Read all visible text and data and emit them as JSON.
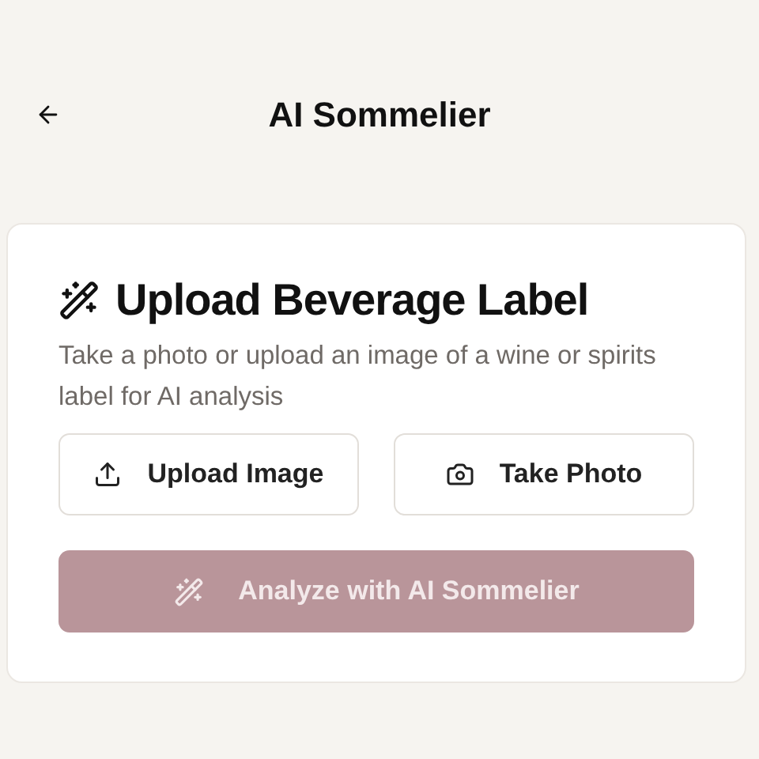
{
  "header": {
    "title": "AI Sommelier"
  },
  "card": {
    "title": "Upload Beverage Label",
    "description": "Take a photo or upload an image of a wine or spirits label for AI analysis",
    "actions": [
      {
        "kind": "upload",
        "label": "Upload Image"
      },
      {
        "kind": "camera",
        "label": "Take Photo"
      }
    ],
    "analyze_button": {
      "label": "Analyze with AI Sommelier",
      "disabled": true
    }
  }
}
